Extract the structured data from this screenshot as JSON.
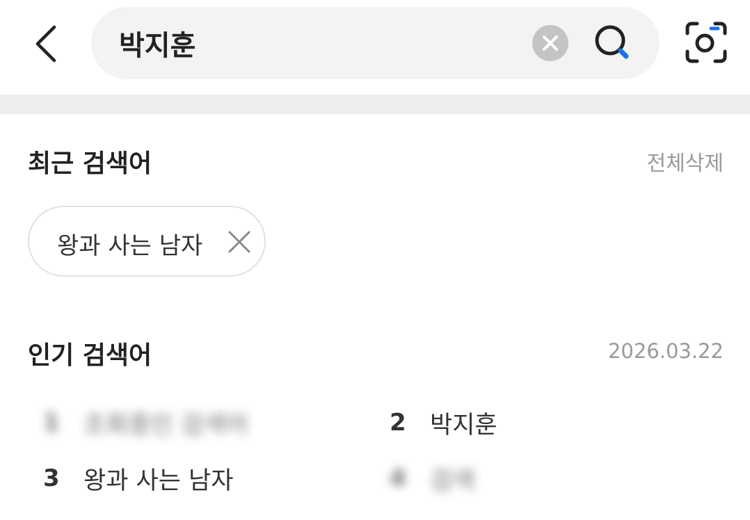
{
  "search": {
    "query": "박지훈",
    "back_icon": "chevron-left-icon",
    "clear_icon": "close-circle-icon",
    "search_icon": "search-icon",
    "lens_icon": "camera-lens-icon",
    "accent_color": "#1a73e8"
  },
  "recent": {
    "title": "최근 검색어",
    "delete_all_label": "전체삭제",
    "items": [
      {
        "label": "왕과 사는 남자",
        "remove_icon": "close-icon"
      }
    ]
  },
  "popular": {
    "title": "인기 검색어",
    "date": "2026.03.22",
    "items": [
      {
        "rank": "1",
        "label": "조회중인 검색어",
        "blurred": true
      },
      {
        "rank": "2",
        "label": "박지훈",
        "blurred": false
      },
      {
        "rank": "3",
        "label": "왕과 사는 남자",
        "blurred": false
      },
      {
        "rank": "4",
        "label": "검색",
        "blurred": true
      }
    ]
  }
}
